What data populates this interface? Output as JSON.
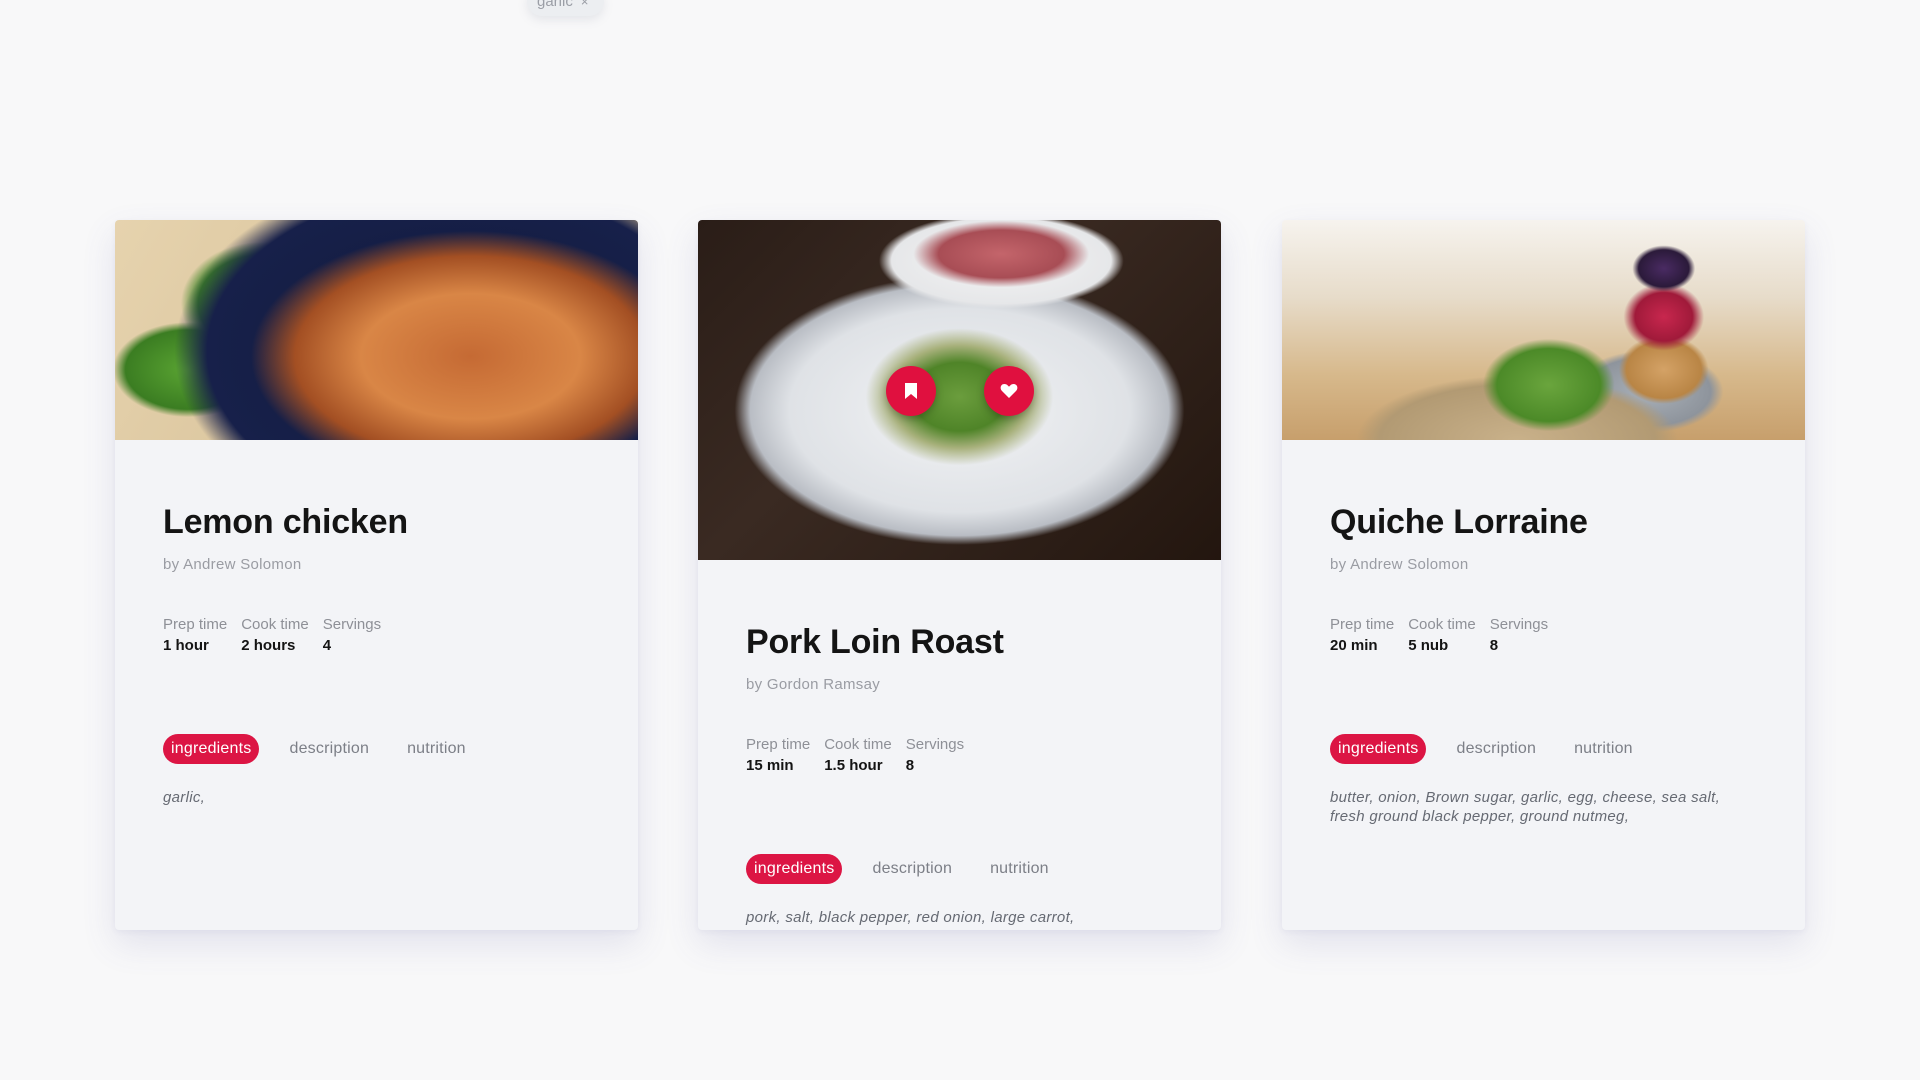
{
  "filter_chip": {
    "label": "garlic",
    "remove_icon": "×"
  },
  "labels": {
    "prep": "Prep time",
    "cook": "Cook time",
    "servings": "Servings"
  },
  "tabs": {
    "ingredients": "ingredients",
    "description": "description",
    "nutrition": "nutrition"
  },
  "accent_color": "#dc1544",
  "cards": [
    {
      "title": "Lemon chicken",
      "author": "by Andrew Solomon",
      "prep": "1 hour",
      "cook": "2 hours",
      "servings": "4",
      "ingredients": "garlic,",
      "image_icon": "shrimp-photo"
    },
    {
      "title": "Pork Loin Roast",
      "author": "by Gordon Ramsay",
      "prep": "15 min",
      "cook": "1.5 hour",
      "servings": "8",
      "ingredients": "pork, salt, black pepper, red onion, large carrot,",
      "image_icon": "salad-photo",
      "overlay_icons": [
        "bookmark-icon",
        "heart-icon"
      ]
    },
    {
      "title": "Quiche Lorraine",
      "author": "by Andrew Solomon",
      "prep": "20 min",
      "cook": "5 nub",
      "servings": "8",
      "ingredients": "butter, onion, Brown sugar, garlic, egg, cheese, sea salt, fresh ground black pepper, ground nutmeg,",
      "image_icon": "quiche-photo"
    }
  ]
}
